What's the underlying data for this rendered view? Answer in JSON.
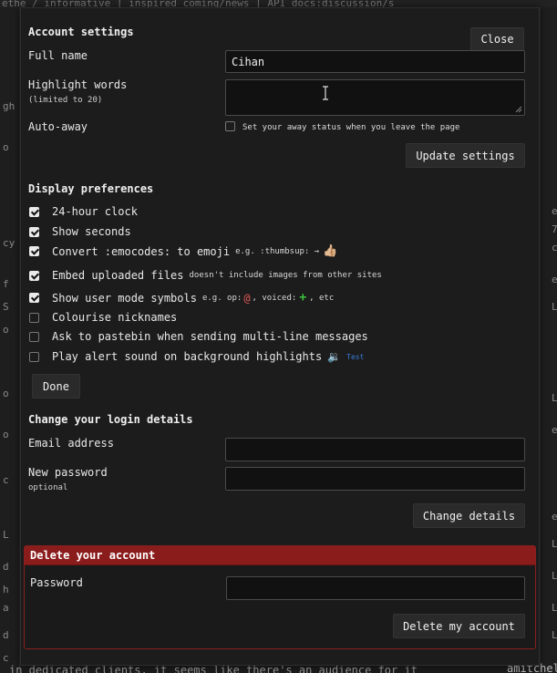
{
  "background": {
    "topbar_text": "ethe / informative | inspired coming/news | API docs:discussion/s",
    "bottom_text": "in dedicated clients, it seems like there's an audience for it",
    "bottom_user": "amitchell",
    "left_marks": [
      "gh",
      "o",
      "cy",
      "f",
      "S",
      "o",
      "o",
      "o",
      "c",
      "L",
      "d",
      "h",
      "a",
      "d",
      "c"
    ],
    "right_marks": [
      "e",
      "7",
      "c",
      "e",
      "L",
      "L",
      "e",
      "e",
      "L",
      "L",
      "L",
      "L"
    ]
  },
  "modal": {
    "close_label": "Close",
    "account": {
      "title": "Account settings",
      "full_name_label": "Full name",
      "full_name_value": "Cihan",
      "highlight_label": "Highlight words",
      "highlight_sublabel": "(limited to 20)",
      "highlight_value": "",
      "autoaway_label": "Auto-away",
      "autoaway_hint": "Set your away status when you leave the page",
      "autoaway_checked": false,
      "update_label": "Update settings"
    },
    "display": {
      "title": "Display preferences",
      "prefs": [
        {
          "label": "24-hour clock",
          "checked": true
        },
        {
          "label": "Show seconds",
          "checked": true
        },
        {
          "label": "Convert :emocodes: to emoji",
          "hint": "e.g. :thumbsup: →",
          "emoji": "👍🏼",
          "checked": true
        },
        {
          "label": "Embed uploaded files",
          "hint": "doesn't include images from other sites",
          "checked": true
        },
        {
          "label": "Show user mode symbols",
          "hint_a": "e.g. op:",
          "op_symbol": "@",
          "hint_b": ", voiced:",
          "voice_symbol": "+",
          "hint_c": ", etc",
          "checked": true
        },
        {
          "label": "Colourise nicknames",
          "checked": false
        },
        {
          "label": "Ask to pastebin when sending multi-line messages",
          "checked": false
        },
        {
          "label": "Play alert sound on background highlights",
          "speaker": "🔉",
          "test_label": "Test",
          "checked": false
        }
      ],
      "done_label": "Done"
    },
    "login": {
      "title": "Change your login details",
      "email_label": "Email address",
      "email_value": "",
      "password_label": "New password",
      "password_sublabel": "optional",
      "password_value": "",
      "change_label": "Change details"
    },
    "delete": {
      "title": "Delete your account",
      "password_label": "Password",
      "password_value": "",
      "delete_label": "Delete my account"
    }
  },
  "colors": {
    "background": "#1b1b1b",
    "modal": "#1c1c1c",
    "danger": "#8b1c1c",
    "link": "#3a7bd5",
    "op": "#e05a5a",
    "voice": "#3cc43c"
  }
}
